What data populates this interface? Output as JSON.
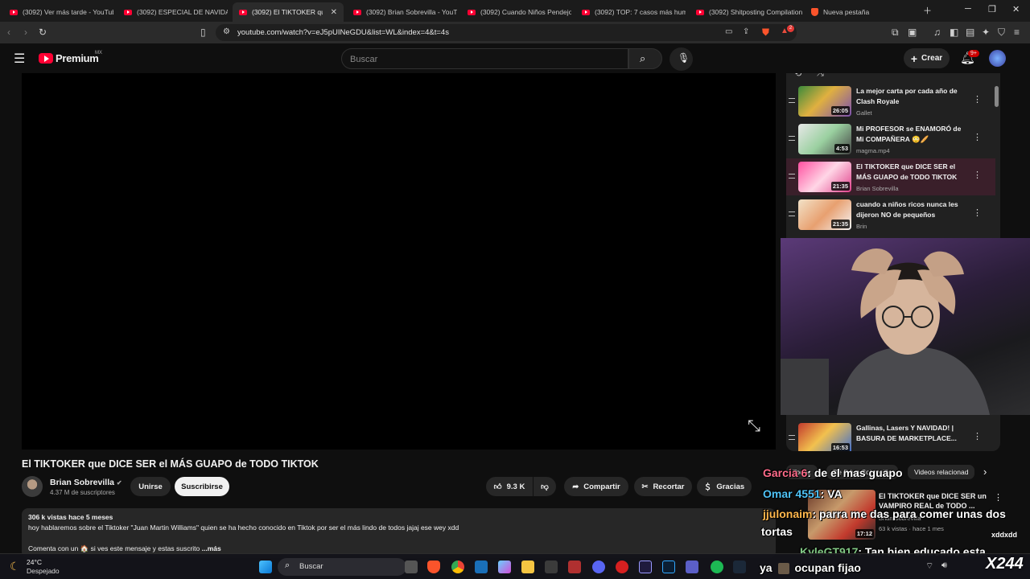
{
  "browser": {
    "tabs": [
      {
        "label": "(3092) Ver más tarde - YouTube",
        "active": false
      },
      {
        "label": "(3092) ESPECIAL DE NAVIDAD",
        "active": false
      },
      {
        "label": "(3092) El TIKTOKER que DI",
        "active": true
      },
      {
        "label": "(3092) Brian Sobrevilla - YouTu",
        "active": false
      },
      {
        "label": "(3092) Cuando Niños Pendejos",
        "active": false
      },
      {
        "label": "(3092) TOP: 7 casos más humil",
        "active": false
      },
      {
        "label": "(3092) Shitposting Compilation",
        "active": false
      },
      {
        "label": "Nueva pestaña",
        "active": false
      }
    ],
    "url": "youtube.com/watch?v=eJ5pUINeGDU&list=WL&index=4&t=4s",
    "ext_badge": "2"
  },
  "youtube": {
    "logo": "Premium",
    "region": "MX",
    "search_placeholder": "Buscar",
    "create_label": "Crear",
    "notif_count": "9+"
  },
  "video": {
    "title": "El TIKTOKER que DICE SER el MÁS GUAPO de TODO TIKTOK",
    "channel": "Brian Sobrevilla",
    "subscribers": "4.37 M de suscriptores",
    "join_label": "Unirse",
    "subscribe_label": "Suscribirse",
    "likes": "9.3 K",
    "share_label": "Compartir",
    "clip_label": "Recortar",
    "thanks_label": "Gracias",
    "views_date": "306 k vistas  hace 5 meses",
    "description_line1": "hoy hablaremos sobre el Tiktoker \"Juan Martin Williams\" quien se ha hecho conocido en Tiktok por ser el más lindo de todos jajaj ese wey xdd",
    "description_line2": "Comenta con un 🏠 si ves este mensaje y estas suscrito",
    "more_label": "...más"
  },
  "playlist": {
    "items": [
      {
        "title": "La mejor carta por cada año de Clash Royale",
        "channel": "Gallet",
        "duration": "26:05",
        "active": false
      },
      {
        "title": "Mi PROFESOR se ENAMORÓ de Mi COMPAÑERA 😳🥖",
        "channel": "magma.mp4",
        "duration": "4:53",
        "active": false
      },
      {
        "title": "El TIKTOKER que DICE SER el MÁS GUAPO de TODO TIKTOK",
        "channel": "Brian Sobrevilla",
        "duration": "21:35",
        "active": true
      },
      {
        "title": "cuando a niños ricos nunca les dijeron NO de pequeños",
        "channel": "Brin",
        "duration": "21:35",
        "active": false
      }
    ],
    "bottom_item": {
      "title": "Gallinas, Lasers Y NAVIDAD! | BASURA DE MARKETPLACE...",
      "duration": "16:53"
    }
  },
  "chips": [
    "Todos",
    "De Brian Sobrevilla",
    "Videos relacionad"
  ],
  "related": {
    "title": "El TIKTOKER que DICE SER un VAMPIRO REAL de TODO ...",
    "channel": "Brian Sobrevilla",
    "meta": "63 k vistas · hace 1 mes",
    "duration": "17:12"
  },
  "chat_overlay": [
    {
      "user": "Garcia 6",
      "message": ": de el mas guapo",
      "user_color": "#ff6b8a"
    },
    {
      "user": "Omar 4551",
      "message": ": VA",
      "user_color": "#4fc3f7"
    },
    {
      "user": "jjulonaim",
      "message": ": parra me das para comer unas dos",
      "user_color": "#ffb74d"
    },
    {
      "user": "",
      "message": "tortas",
      "user_color": "#ffffff"
    },
    {
      "user": "KyleGT917",
      "message": ": Tan bien educado esta",
      "user_color": "#81c784"
    },
    {
      "user": "ya",
      "message": "ocupan fijao",
      "user_color": "#ffffff"
    }
  ],
  "stream_badge": "X244",
  "stream_badge_small": "xddxdd",
  "taskbar": {
    "weather_temp": "24°C",
    "weather_status": "Despejado",
    "search_label": "Buscar"
  }
}
